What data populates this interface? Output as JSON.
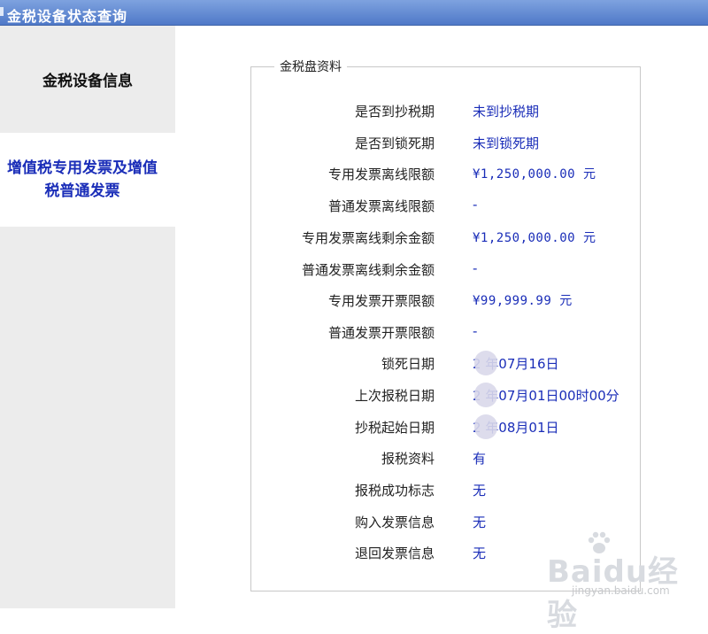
{
  "window": {
    "title": "金税设备状态查询"
  },
  "sidebar": {
    "items": [
      {
        "label": "金税设备信息"
      },
      {
        "label": "增值税专用发票及增值税普通发票"
      }
    ]
  },
  "panel": {
    "legend": "金税盘资料",
    "rows": [
      {
        "label": "是否到抄税期",
        "value": "未到抄税期"
      },
      {
        "label": "是否到锁死期",
        "value": "未到锁死期"
      },
      {
        "label": "专用发票离线限额",
        "value": "¥1,250,000.00 元"
      },
      {
        "label": "普通发票离线限额",
        "value": "-"
      },
      {
        "label": "专用发票离线剩余金额",
        "value": "¥1,250,000.00 元"
      },
      {
        "label": "普通发票离线剩余金额",
        "value": "-"
      },
      {
        "label": "专用发票开票限额",
        "value": "¥99,999.99 元"
      },
      {
        "label": "普通发票开票限额",
        "value": "-"
      },
      {
        "label": "锁死日期",
        "value": "2  年07月16日"
      },
      {
        "label": "上次报税日期",
        "value": "2  年07月01日00时00分"
      },
      {
        "label": "抄税起始日期",
        "value": "2  年08月01日"
      },
      {
        "label": "报税资料",
        "value": "有"
      },
      {
        "label": "报税成功标志",
        "value": "无"
      },
      {
        "label": "购入发票信息",
        "value": "无"
      },
      {
        "label": "退回发票信息",
        "value": "无"
      }
    ]
  },
  "watermark": {
    "logo": "Baidu经验",
    "site": "jingyan.baidu.com"
  }
}
